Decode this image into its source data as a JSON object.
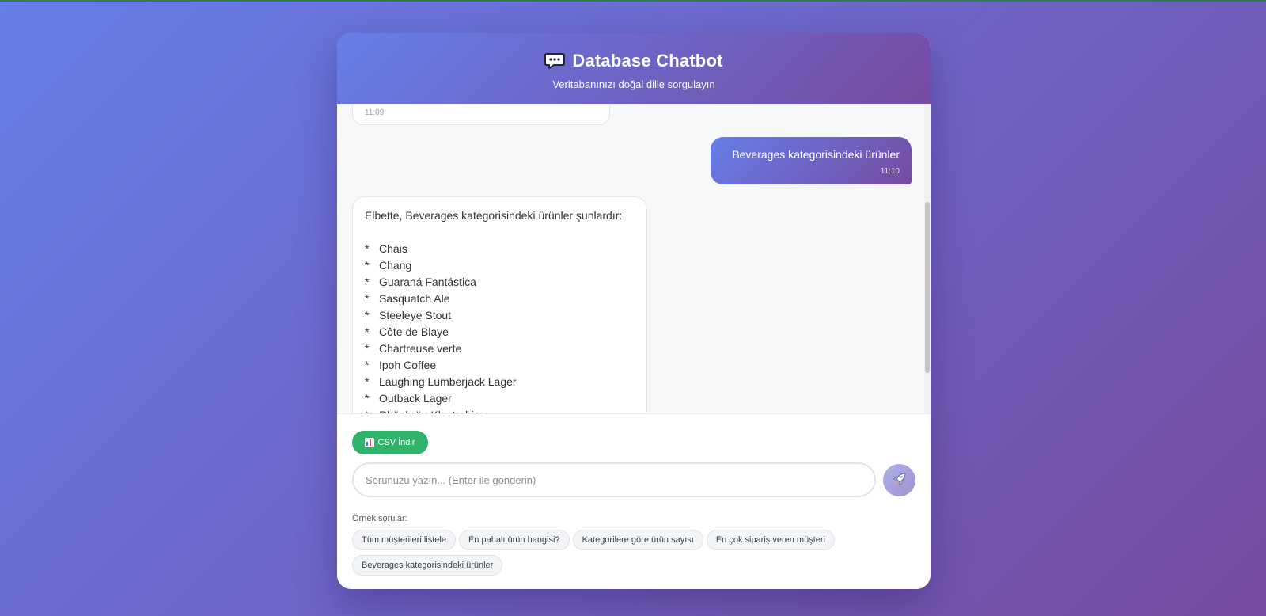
{
  "header": {
    "title": "Database Chatbot",
    "subtitle": "Veritabanınızı doğal dille sorgulayın",
    "icon": "speech-bubble-icon"
  },
  "messages": {
    "previous_bot": {
      "time": "11:09"
    },
    "user": {
      "text": "Beverages kategorisindeki ürünler",
      "time": "11:10"
    },
    "bot": {
      "intro": "Elbette, Beverages kategorisindeki ürünler şunlardır:",
      "bullet": "*",
      "items": [
        "Chais",
        "Chang",
        "Guaraná Fantástica",
        "Sasquatch Ale",
        "Steeleye Stout",
        "Côte de Blaye",
        "Chartreuse verte",
        "Ipoh Coffee",
        "Laughing Lumberjack Lager",
        "Outback Lager",
        "Rhönbräu Klosterbier"
      ]
    }
  },
  "actions": {
    "csv_label": "CSV İndir"
  },
  "input": {
    "placeholder": "Sorunuzu yazın... (Enter ile gönderin)",
    "value": ""
  },
  "examples": {
    "label": "Örnek sorular:",
    "chips": [
      "Tüm müşterileri listele",
      "En pahalı ürün hangisi?",
      "Kategorilere göre ürün sayısı",
      "En çok sipariş veren müşteri",
      "Beverages kategorisindeki ürünler"
    ]
  },
  "colors": {
    "gradient_start": "#667eea",
    "gradient_end": "#764ba2",
    "csv_button": "#2fb36a"
  }
}
